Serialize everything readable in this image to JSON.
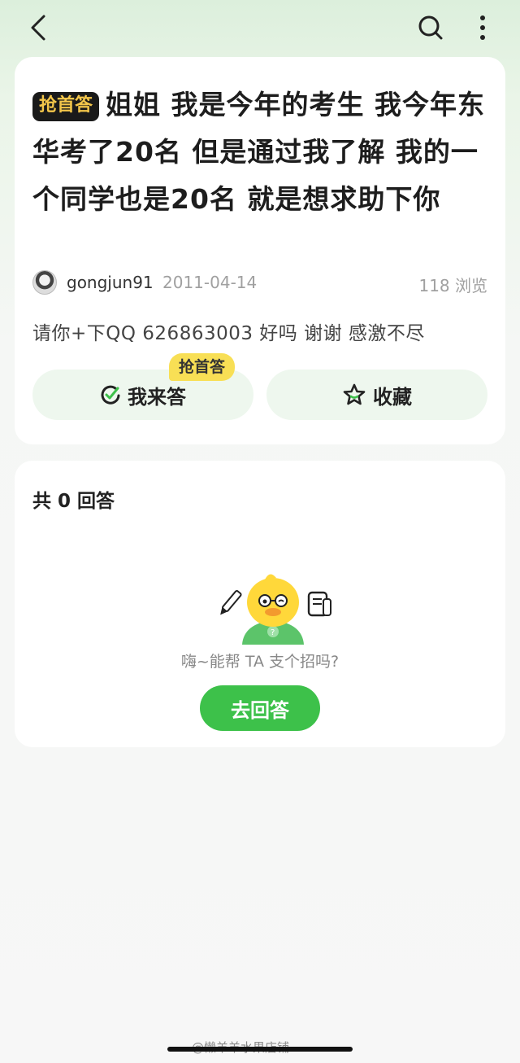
{
  "question": {
    "badge": "抢首答",
    "title": "姐姐 我是今年的考生 我今年东华考了20名 但是通过我了解 我的一个同学也是20名 就是想求助下你",
    "author": "gongjun91",
    "date": "2011-04-14",
    "views": "118 浏览",
    "body": "请你+下QQ 626863003 好吗 谢谢 感激不尽"
  },
  "actions": {
    "floating_badge": "抢首答",
    "answer_label": "我来答",
    "collect_label": "收藏"
  },
  "answers": {
    "count_label": "共 0 回答",
    "empty_prompt": "嗨~能帮 TA 支个招吗?",
    "go_answer_label": "去回答"
  },
  "watermark": "@懒羊羊水果店铺",
  "colors": {
    "accent_green": "#3dc14a",
    "badge_dark": "#1a1a1a",
    "badge_gold": "#f3c64a",
    "badge_yellow": "#f8df55"
  },
  "icons": {
    "back": "chevron-left-icon",
    "search": "search-icon",
    "more": "more-vertical-icon",
    "answer": "edit-check-icon",
    "collect": "star-icon"
  }
}
